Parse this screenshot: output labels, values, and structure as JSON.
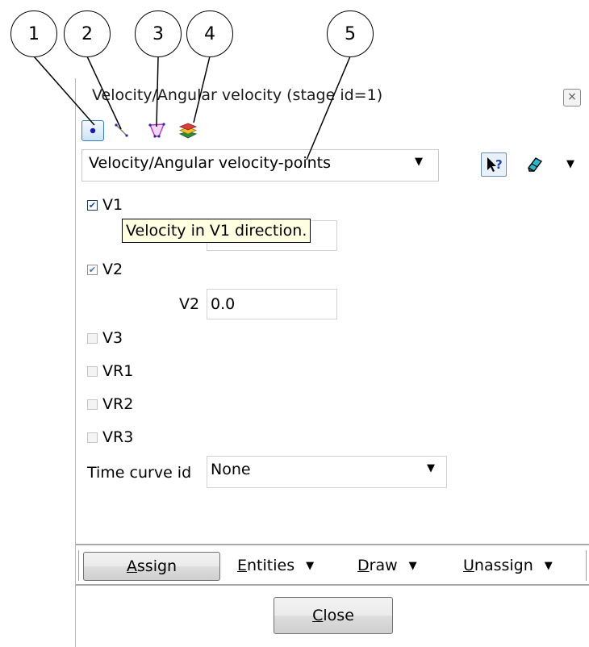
{
  "callouts": [
    "1",
    "2",
    "3",
    "4",
    "5"
  ],
  "window": {
    "title": "Velocity/Angular velocity (stage id=1)",
    "close_label": "×"
  },
  "toolbar": {
    "tools": [
      {
        "name": "point-entity-icon",
        "selected": true
      },
      {
        "name": "line-entity-icon",
        "selected": false
      },
      {
        "name": "surface-entity-icon",
        "selected": false
      },
      {
        "name": "volume-layers-icon",
        "selected": false
      }
    ]
  },
  "condition_select": {
    "value": "Velocity/Angular velocity-points",
    "arrow": "▼"
  },
  "help_icon": "help-pointer-icon",
  "eraser_icon": "eraser-icon",
  "checkboxes": [
    {
      "label": "V1",
      "checked": true,
      "enabled": true
    },
    {
      "label": "V2",
      "checked": true,
      "enabled": false
    },
    {
      "label": "V3",
      "checked": false,
      "enabled": false
    },
    {
      "label": "VR1",
      "checked": false,
      "enabled": false
    },
    {
      "label": "VR2",
      "checked": false,
      "enabled": false
    },
    {
      "label": "VR3",
      "checked": false,
      "enabled": false
    }
  ],
  "fields": {
    "v2_label": "V2",
    "v2_value": "0.0"
  },
  "tooltip": "Velocity in V1 direction.",
  "time_curve": {
    "label": "Time curve id",
    "value": "None"
  },
  "bottom": {
    "assign_underlined": "A",
    "assign_rest": "ssign",
    "entities_underlined": "E",
    "entities_rest": "ntities",
    "draw_underlined": "D",
    "draw_rest": "raw",
    "unassign_underlined": "U",
    "unassign_rest": "nassign"
  },
  "close_button": {
    "underlined": "C",
    "rest": "lose"
  }
}
